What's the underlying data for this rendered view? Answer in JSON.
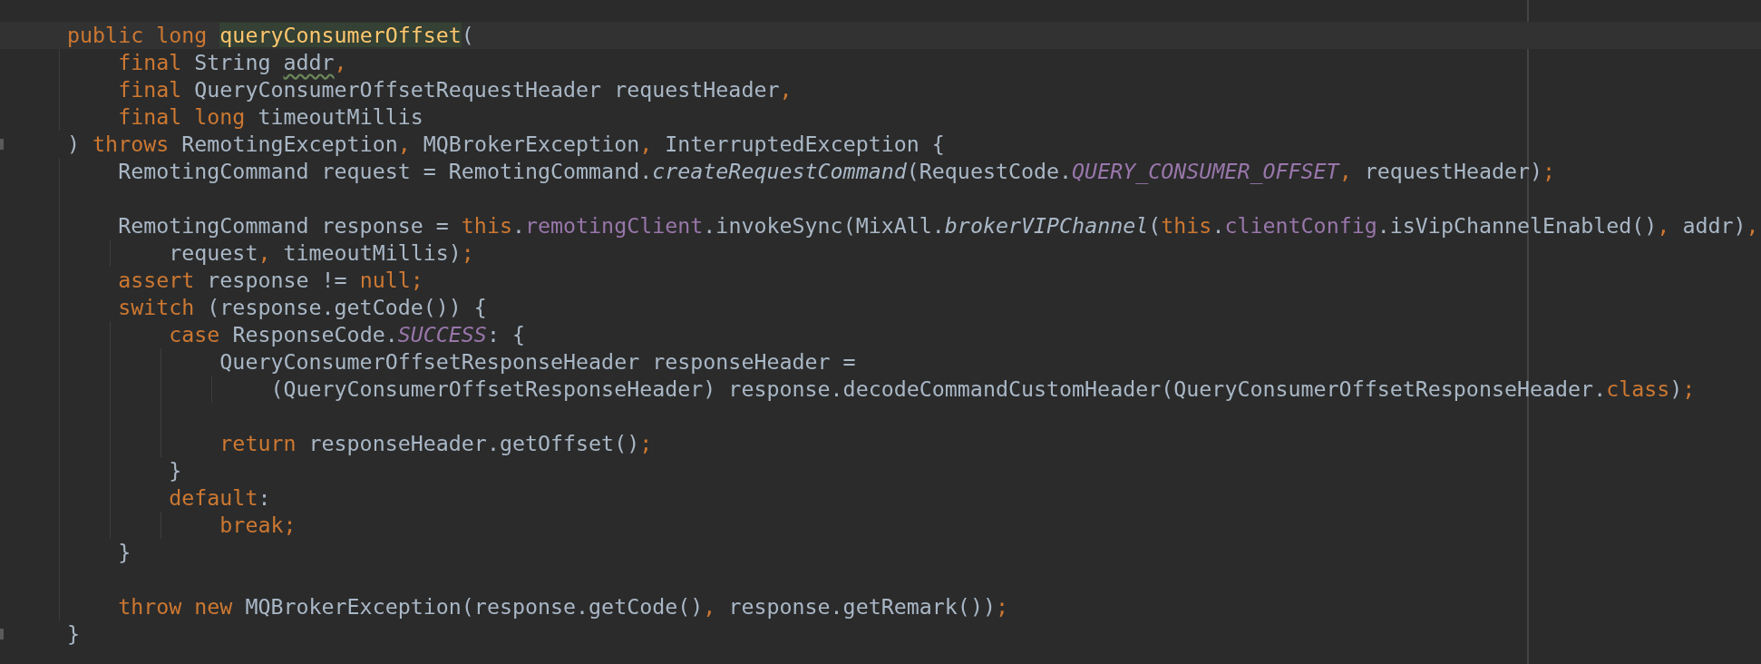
{
  "editor": {
    "lines": [
      {
        "current": true,
        "fold_end": false,
        "tokens": [
          {
            "kind": "keyword",
            "text": "public long "
          },
          {
            "kind": "method_decl",
            "text": "queryConsumerOffset"
          },
          {
            "kind": "plain",
            "text": "("
          }
        ],
        "children": [
          {
            "current": false,
            "fold_end": false,
            "tokens": [
              {
                "kind": "keyword",
                "text": "final "
              },
              {
                "kind": "plain",
                "text": "String "
              },
              {
                "kind": "warning",
                "text": "addr"
              },
              {
                "kind": "punct",
                "text": ","
              }
            ]
          },
          {
            "current": false,
            "fold_end": false,
            "tokens": [
              {
                "kind": "keyword",
                "text": "final "
              },
              {
                "kind": "plain",
                "text": "QueryConsumerOffsetRequestHeader requestHeader"
              },
              {
                "kind": "punct",
                "text": ","
              }
            ]
          },
          {
            "current": false,
            "fold_end": false,
            "tokens": [
              {
                "kind": "keyword",
                "text": "final long "
              },
              {
                "kind": "plain",
                "text": "timeoutMillis"
              }
            ]
          }
        ]
      },
      {
        "current": false,
        "fold_end": true,
        "tokens": [
          {
            "kind": "plain",
            "text": ") "
          },
          {
            "kind": "keyword",
            "text": "throws "
          },
          {
            "kind": "plain",
            "text": "RemotingException"
          },
          {
            "kind": "punct",
            "text": ", "
          },
          {
            "kind": "plain",
            "text": "MQBrokerException"
          },
          {
            "kind": "punct",
            "text": ", "
          },
          {
            "kind": "plain",
            "text": "InterruptedException {"
          }
        ],
        "children": [
          {
            "current": false,
            "fold_end": false,
            "tokens": [
              {
                "kind": "plain",
                "text": "RemotingCommand request = RemotingCommand."
              },
              {
                "kind": "static_method",
                "text": "createRequestCommand"
              },
              {
                "kind": "plain",
                "text": "(RequestCode."
              },
              {
                "kind": "constant",
                "text": "QUERY_CONSUMER_OFFSET"
              },
              {
                "kind": "punct",
                "text": ", "
              },
              {
                "kind": "plain",
                "text": "requestHeader)"
              },
              {
                "kind": "punct",
                "text": ";"
              }
            ]
          },
          {
            "current": false,
            "fold_end": false
          },
          {
            "current": false,
            "fold_end": false,
            "tokens": [
              {
                "kind": "plain",
                "text": "RemotingCommand response = "
              },
              {
                "kind": "keyword",
                "text": "this"
              },
              {
                "kind": "plain",
                "text": "."
              },
              {
                "kind": "field",
                "text": "remotingClient"
              },
              {
                "kind": "plain",
                "text": ".invokeSync(MixAll."
              },
              {
                "kind": "static_method",
                "text": "brokerVIPChannel"
              },
              {
                "kind": "plain",
                "text": "("
              },
              {
                "kind": "keyword",
                "text": "this"
              },
              {
                "kind": "plain",
                "text": "."
              },
              {
                "kind": "field",
                "text": "clientConfig"
              },
              {
                "kind": "plain",
                "text": ".isVipChannelEnabled()"
              },
              {
                "kind": "punct",
                "text": ", "
              },
              {
                "kind": "plain",
                "text": "addr)"
              },
              {
                "kind": "punct",
                "text": ","
              }
            ],
            "children": [
              {
                "current": false,
                "fold_end": false,
                "tokens": [
                  {
                    "kind": "plain",
                    "text": "request"
                  },
                  {
                    "kind": "punct",
                    "text": ", "
                  },
                  {
                    "kind": "plain",
                    "text": "timeoutMillis)"
                  },
                  {
                    "kind": "punct",
                    "text": ";"
                  }
                ]
              }
            ]
          },
          {
            "current": false,
            "fold_end": false,
            "tokens": [
              {
                "kind": "keyword",
                "text": "assert "
              },
              {
                "kind": "plain",
                "text": "response != "
              },
              {
                "kind": "keyword",
                "text": "null"
              },
              {
                "kind": "punct",
                "text": ";"
              }
            ]
          },
          {
            "current": false,
            "fold_end": false,
            "tokens": [
              {
                "kind": "keyword",
                "text": "switch "
              },
              {
                "kind": "plain",
                "text": "(response.getCode()) {"
              }
            ],
            "children": [
              {
                "current": false,
                "fold_end": false,
                "tokens": [
                  {
                    "kind": "keyword",
                    "text": "case "
                  },
                  {
                    "kind": "plain",
                    "text": "ResponseCode."
                  },
                  {
                    "kind": "constant",
                    "text": "SUCCESS"
                  },
                  {
                    "kind": "plain",
                    "text": ": {"
                  }
                ],
                "children": [
                  {
                    "current": false,
                    "fold_end": false,
                    "tokens": [
                      {
                        "kind": "plain",
                        "text": "QueryConsumerOffsetResponseHeader responseHeader ="
                      }
                    ],
                    "children": [
                      {
                        "current": false,
                        "fold_end": false,
                        "tokens": [
                          {
                            "kind": "plain",
                            "text": "(QueryConsumerOffsetResponseHeader) response.decodeCommandCustomHeader(QueryConsumerOffsetResponseHeader."
                          },
                          {
                            "kind": "keyword",
                            "text": "class"
                          },
                          {
                            "kind": "plain",
                            "text": ")"
                          },
                          {
                            "kind": "punct",
                            "text": ";"
                          }
                        ]
                      }
                    ]
                  },
                  {
                    "current": false,
                    "fold_end": false
                  },
                  {
                    "current": false,
                    "fold_end": false,
                    "tokens": [
                      {
                        "kind": "keyword",
                        "text": "return "
                      },
                      {
                        "kind": "plain",
                        "text": "responseHeader.getOffset()"
                      },
                      {
                        "kind": "punct",
                        "text": ";"
                      }
                    ]
                  }
                ]
              },
              {
                "current": false,
                "fold_end": false,
                "tokens": [
                  {
                    "kind": "plain",
                    "text": "}"
                  }
                ]
              },
              {
                "current": false,
                "fold_end": false,
                "tokens": [
                  {
                    "kind": "keyword",
                    "text": "default"
                  },
                  {
                    "kind": "plain",
                    "text": ":"
                  }
                ],
                "children": [
                  {
                    "current": false,
                    "fold_end": false,
                    "tokens": [
                      {
                        "kind": "keyword",
                        "text": "break"
                      },
                      {
                        "kind": "punct",
                        "text": ";"
                      }
                    ]
                  }
                ]
              }
            ]
          },
          {
            "current": false,
            "fold_end": false,
            "tokens": [
              {
                "kind": "plain",
                "text": "}"
              }
            ]
          },
          {
            "current": false,
            "fold_end": false
          },
          {
            "current": false,
            "fold_end": false,
            "tokens": [
              {
                "kind": "keyword",
                "text": "throw new "
              },
              {
                "kind": "plain",
                "text": "MQBrokerException(response.getCode()"
              },
              {
                "kind": "punct",
                "text": ", "
              },
              {
                "kind": "plain",
                "text": "response.getRemark())"
              },
              {
                "kind": "punct",
                "text": ";"
              }
            ]
          }
        ]
      },
      {
        "current": false,
        "fold_end": true,
        "tokens": [
          {
            "kind": "plain",
            "text": "}"
          }
        ]
      }
    ]
  }
}
